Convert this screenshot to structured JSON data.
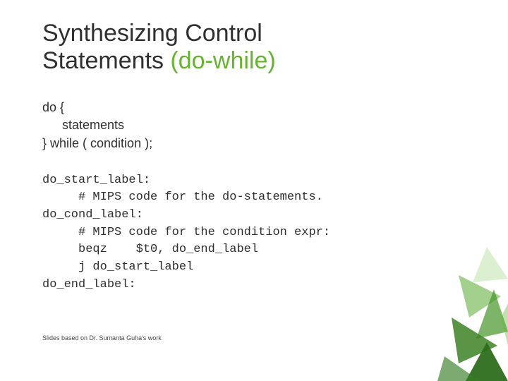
{
  "title_line1": "Synthesizing Control",
  "title_line2_plain": "Statements ",
  "title_line2_accent": "(do-while)",
  "pseudo": {
    "l1": "do {",
    "l2": "statements",
    "l3": "} while ( condition );"
  },
  "code": "do_start_label:\n     # MIPS code for the do-statements.\ndo_cond_label:\n     # MIPS code for the condition expr:\n     beqz    $t0, do_end_label\n     j do_start_label\ndo_end_label:",
  "footer": "Slides based on Dr. Sumanta Guha's work"
}
